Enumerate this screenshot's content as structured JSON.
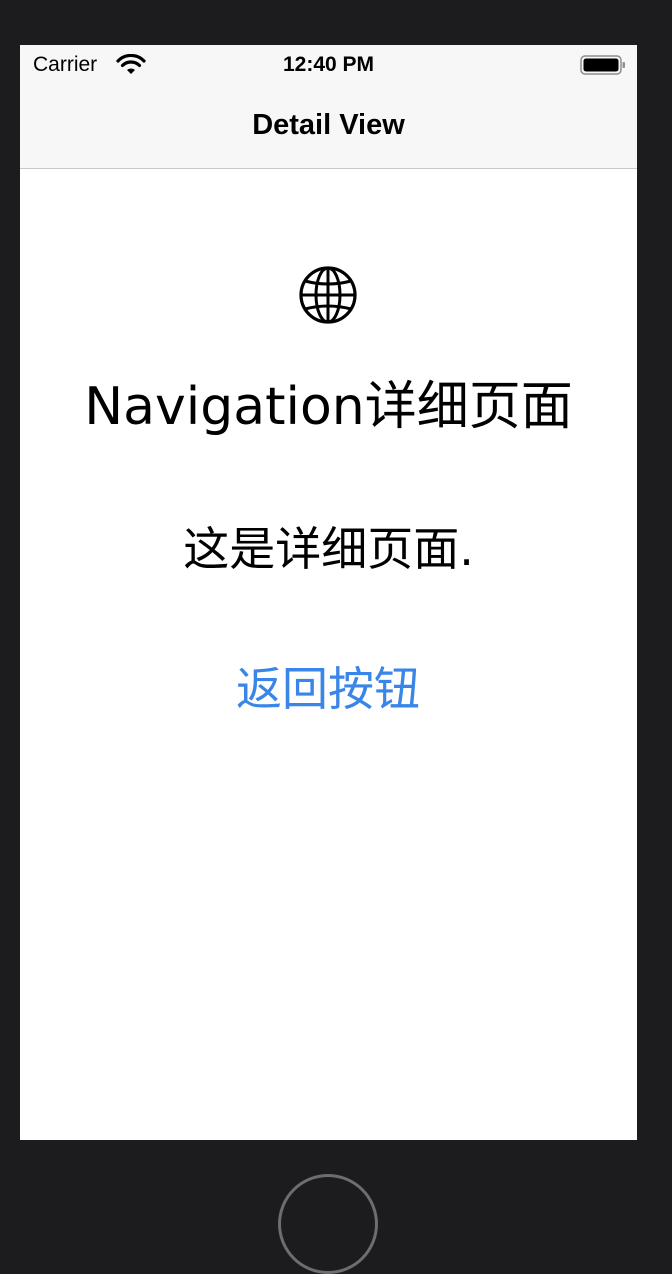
{
  "status_bar": {
    "carrier": "Carrier",
    "time": "12:40 PM",
    "wifi_icon": "wifi-icon",
    "battery_icon": "battery-icon"
  },
  "nav_bar": {
    "title": "Detail View"
  },
  "content": {
    "icon": "globe-icon",
    "heading": "Navigation详细页面",
    "body": "这是详细页面.",
    "back_button_label": "返回按钮"
  },
  "colors": {
    "accent": "#3a85e8",
    "background": "#ffffff",
    "bar_background": "#f7f7f7",
    "frame": "#1c1c1e"
  }
}
